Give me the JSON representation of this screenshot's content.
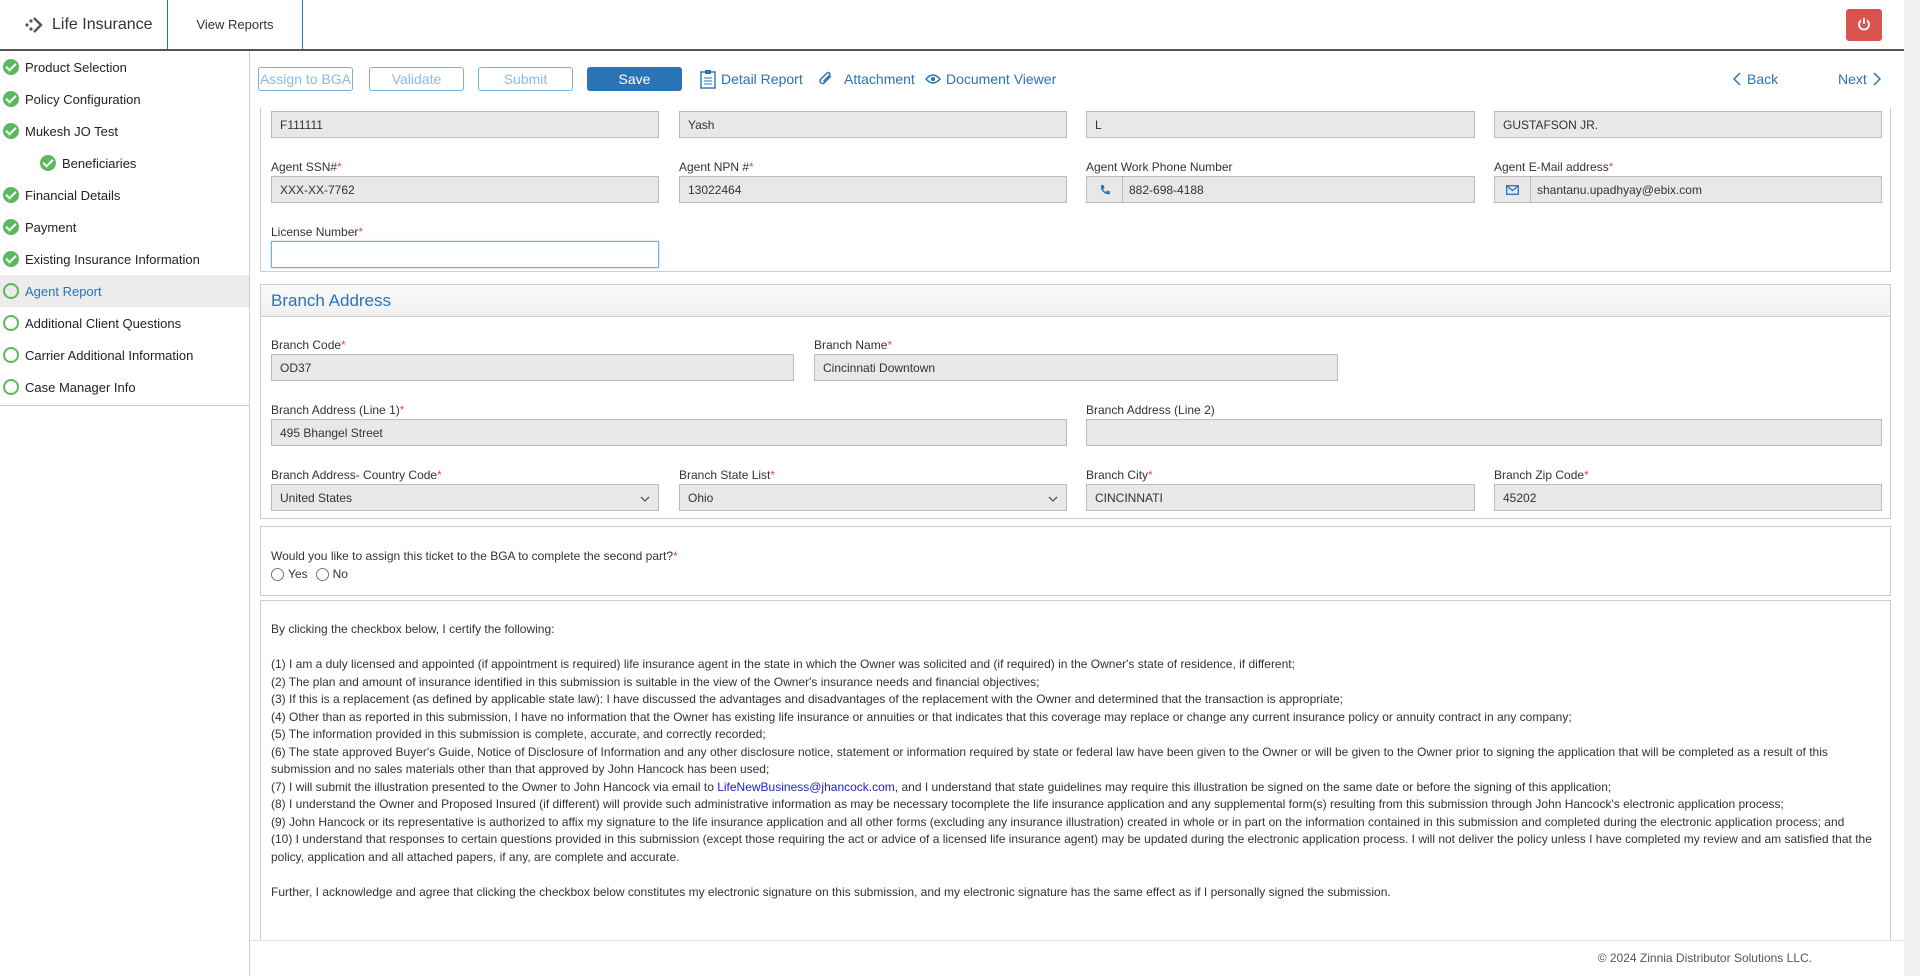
{
  "header": {
    "app_title": "Life Insurance",
    "view_reports": "View Reports"
  },
  "sidebar": {
    "items": [
      {
        "label": "Product Selection",
        "status": "complete"
      },
      {
        "label": "Policy Configuration",
        "status": "complete"
      },
      {
        "label": "Mukesh JO Test",
        "status": "complete"
      },
      {
        "label": "Beneficiaries",
        "status": "complete"
      },
      {
        "label": "Financial Details",
        "status": "complete"
      },
      {
        "label": "Payment",
        "status": "complete"
      },
      {
        "label": "Existing Insurance Information",
        "status": "complete"
      },
      {
        "label": "Agent Report",
        "status": "current"
      },
      {
        "label": "Additional Client Questions",
        "status": "pending"
      },
      {
        "label": "Carrier Additional Information",
        "status": "pending"
      },
      {
        "label": "Case Manager Info",
        "status": "pending"
      }
    ]
  },
  "toolbar": {
    "assign_label": "Assign to BGA",
    "validate_label": "Validate",
    "submit_label": "Submit",
    "save_label": "Save",
    "detail_report": "Detail Report",
    "attachment": "Attachment",
    "document_viewer": "Document Viewer",
    "back": "Back",
    "next": "Next"
  },
  "agent": {
    "row1": [
      "F111111",
      "Yash",
      "L",
      "GUSTAFSON JR."
    ],
    "ssn_label": "Agent SSN#",
    "ssn": "XXX-XX-7762",
    "npn_label": "Agent NPN #",
    "npn": "13022464",
    "phone_label": "Agent Work Phone Number",
    "phone": "882-698-4188",
    "email_label": "Agent E-Mail address",
    "email": "shantanu.upadhyay@ebix.com",
    "license_label": "License Number",
    "license": ""
  },
  "branch": {
    "title": "Branch Address",
    "code_label": "Branch Code",
    "code": "OD37",
    "name_label": "Branch Name",
    "name": "Cincinnati Downtown",
    "line1_label": "Branch Address (Line 1)",
    "line1": "495 Bhangel Street",
    "line2_label": "Branch Address (Line 2)",
    "line2": "",
    "country_label": "Branch Address- Country Code",
    "country": "United States",
    "state_label": "Branch State List",
    "state": "Ohio",
    "city_label": "Branch City",
    "city": "CINCINNATI",
    "zip_label": "Branch Zip Code",
    "zip": "45202"
  },
  "bga": {
    "question": "Would you like to assign this ticket to the BGA to complete the second part?",
    "yes": "Yes",
    "no": "No"
  },
  "certification": {
    "intro": "By clicking the checkbox below, I certify the following:",
    "items": [
      "(1) I am a duly licensed and appointed (if appointment is required) life insurance agent in the state in which the Owner was solicited and (if required) in the Owner's state of residence, if different;",
      "(2) The plan and amount of insurance identified in this submission is suitable in the view of the Owner's insurance needs and financial objectives;",
      "(3) If this is a replacement (as defined by applicable state law): I have discussed the advantages and disadvantages of the replacement with the Owner and determined that the transaction is appropriate;",
      "(4) Other than as reported in this submission, I have no information that the Owner has existing life insurance or annuities or that indicates that this coverage may replace or change any current insurance policy or annuity contract in any company;",
      "(5) The information provided in this submission is complete, accurate, and correctly recorded;",
      "(6) The state approved Buyer's Guide, Notice of Disclosure of Information and any other disclosure notice, statement or information required by state or federal law have been given to the Owner or will be given to the Owner prior to signing the application that will be completed as a result of this submission and no sales materials other than that approved by John Hancock has been used;"
    ],
    "item7_pre": "(7) I will submit the illustration presented to the Owner to John Hancock via email to ",
    "item7_link": "LifeNewBusiness@jhancock.com",
    "item7_post": ", and I understand that state guidelines may require this illustration be signed on the same date or before the signing of this application;",
    "items_after": [
      "(8) I understand the Owner and Proposed Insured (if different) will provide such administrative information as may be necessary tocomplete the life insurance application and any supplemental form(s) resulting from this submission through John Hancock's electronic application process;",
      "(9) John Hancock or its representative is authorized to affix my signature to the life insurance application and all other forms (excluding any insurance illustration) created in whole or in part on the information contained in this submission and completed during the electronic application process; and",
      "(10) I understand that responses to certain questions provided in this submission (except those requiring the act or advice of a licensed life insurance agent) may be updated during the electronic application process. I will not deliver the policy unless I have completed my review and am satisfied that the policy, application and all attached papers, if any, are complete and accurate."
    ],
    "closing": "Further, I acknowledge and agree that clicking the checkbox below constitutes my electronic signature on this submission, and my electronic signature has the same effect as if I personally signed the submission."
  },
  "footer": {
    "copyright": "© 2024 Zinnia Distributor Solutions LLC."
  },
  "colors": {
    "accent": "#2a73b5",
    "complete": "#5cb85c",
    "required": "#d9534f",
    "power": "#d9534f"
  }
}
